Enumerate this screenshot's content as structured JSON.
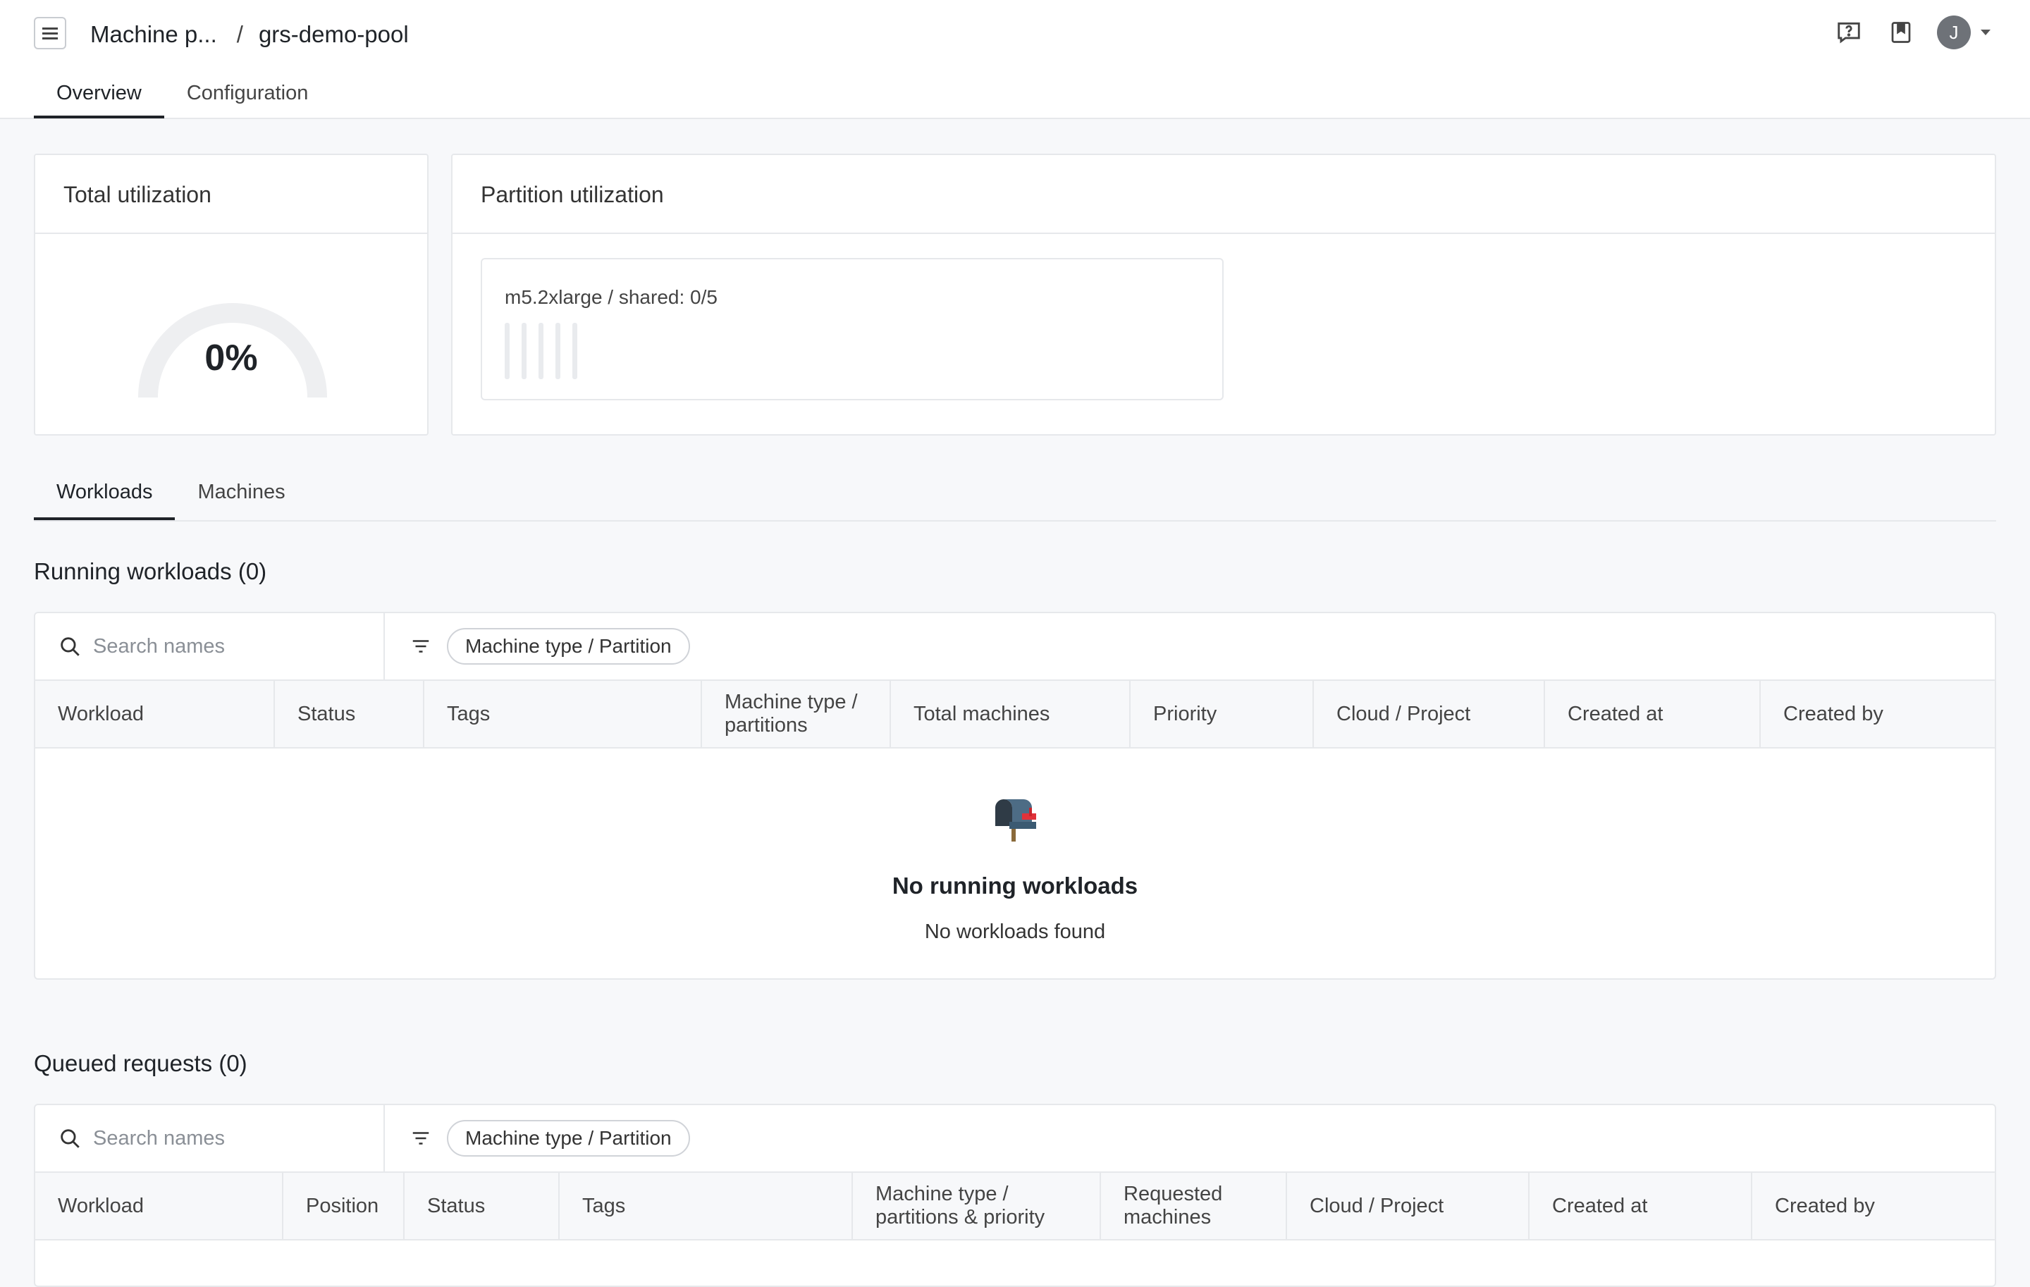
{
  "header": {
    "breadcrumb_parent": "Machine p...",
    "breadcrumb_separator": "/",
    "breadcrumb_current": "grs-demo-pool",
    "avatar_initial": "J",
    "icons": [
      "menu-icon",
      "help-icon",
      "bookmark-icon",
      "avatar",
      "chevron-down-icon"
    ]
  },
  "tabs": {
    "overview": "Overview",
    "configuration": "Configuration",
    "active": "Overview"
  },
  "total_utilization": {
    "title": "Total utilization",
    "value_label": "0%",
    "fraction": 0
  },
  "partition_utilization": {
    "title": "Partition utilization",
    "partitions": [
      {
        "label": "m5.2xlarge / shared: 0/5",
        "used": 0,
        "total": 5
      }
    ]
  },
  "subtabs": {
    "workloads": "Workloads",
    "machines": "Machines",
    "active": "Workloads"
  },
  "running": {
    "title": "Running workloads (0)",
    "search_placeholder": "Search names",
    "filter_chip": "Machine type / Partition",
    "columns": [
      "Workload",
      "Status",
      "Tags",
      "Machine type / partitions",
      "Total machines",
      "Priority",
      "Cloud / Project",
      "Created at",
      "Created by"
    ],
    "empty_title": "No running workloads",
    "empty_subtitle": "No workloads found"
  },
  "queued": {
    "title": "Queued requests (0)",
    "search_placeholder": "Search names",
    "filter_chip": "Machine type / Partition",
    "columns": [
      "Workload",
      "Position",
      "Status",
      "Tags",
      "Machine type / partitions & priority",
      "Requested machines",
      "Cloud / Project",
      "Created at",
      "Created by"
    ]
  },
  "colors": {
    "border": "#e6e8eb",
    "background": "#f7f8fa",
    "gauge_track": "#eeeff1",
    "text": "#1f2328"
  }
}
